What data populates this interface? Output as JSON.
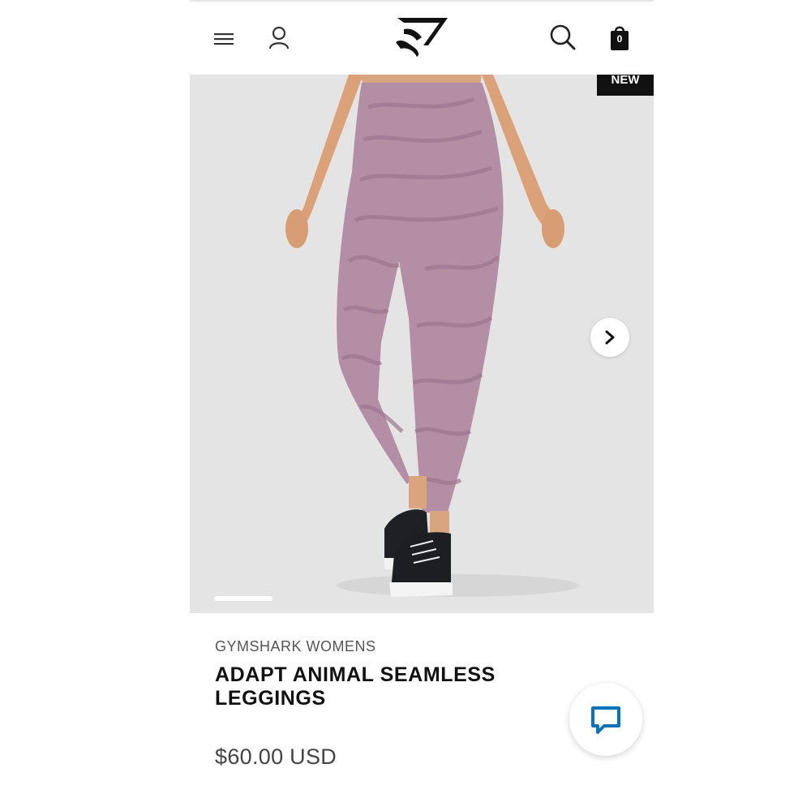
{
  "header": {
    "icons": [
      "menu-icon",
      "account-icon",
      "gymshark-logo",
      "search-icon",
      "shopping-bag-icon"
    ],
    "bag_count": "0"
  },
  "gallery": {
    "badge": "NEW",
    "background_color": "#e4e4e4",
    "product_color": "#b48ea4"
  },
  "product": {
    "brand": "GYMSHARK WOMENS",
    "title": "ADAPT ANIMAL SEAMLESS LEGGINGS",
    "price": "$60.00 USD"
  },
  "chat": {
    "icon": "chat-icon",
    "accent": "#0b74b8"
  }
}
